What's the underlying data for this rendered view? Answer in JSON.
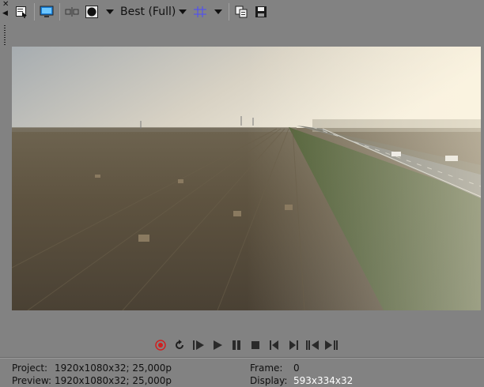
{
  "toolbar": {
    "quality_label": "Best (Full)",
    "icons": [
      "properties-icon",
      "monitor-icon",
      "split-screen-icon",
      "overlay-icon",
      "grid-icon",
      "copy-snapshot-icon",
      "save-snapshot-icon"
    ]
  },
  "status": {
    "project_label": "Project:",
    "project_value": "1920x1080x32; 25,000p",
    "preview_label": "Preview:",
    "preview_value": "1920x1080x32; 25,000p",
    "frame_label": "Frame:",
    "frame_value": "0",
    "display_label": "Display:",
    "display_value": "593x334x32"
  },
  "transport": [
    "record-icon",
    "loop-icon",
    "play-from-start-icon",
    "play-icon",
    "pause-icon",
    "stop-icon",
    "previous-marker-icon",
    "next-marker-icon",
    "previous-frame-icon",
    "next-frame-icon"
  ],
  "colors": {
    "background": "#828282",
    "record": "#d02020",
    "grid": "#4a4aff"
  }
}
